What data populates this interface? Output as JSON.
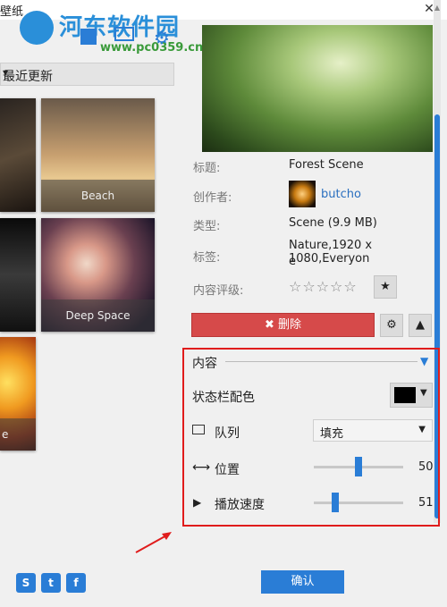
{
  "window": {
    "title": "壁纸",
    "close_label": "✕"
  },
  "watermark": {
    "name": "河东软件园",
    "url": "www.pc0359.cn"
  },
  "sort": {
    "selected": "最近更新"
  },
  "wallpapers": [
    {
      "caption": "Beach"
    },
    {
      "caption": "Deep Space"
    },
    {
      "caption": "e"
    }
  ],
  "details": {
    "title_label": "标题:",
    "title_value": "Forest Scene",
    "author_label": "创作者:",
    "author_value": "butcho",
    "type_label": "类型:",
    "type_value": "Scene (9.9 MB)",
    "tags_label": "标签:",
    "tags_value_line1": "Nature,1920 x 1080,Everyon",
    "tags_value_line2": "e",
    "rating_label": "内容评级:",
    "rating_stars": "☆☆☆☆☆",
    "favorite_glyph": "★"
  },
  "actions": {
    "delete_label": "✖ 删除"
  },
  "content_section": {
    "header": "内容",
    "statusbar_color_label": "状态栏配色",
    "statusbar_color": "#000000",
    "queue_label": "队列",
    "queue_value": "填充",
    "position_label": "位置",
    "position_value": "50",
    "speed_label": "播放速度",
    "speed_value": "51"
  },
  "footer": {
    "confirm_label": "确认"
  },
  "colors": {
    "accent": "#2a7dd6",
    "danger": "#d64a4a",
    "annotation": "#e01c1c"
  }
}
